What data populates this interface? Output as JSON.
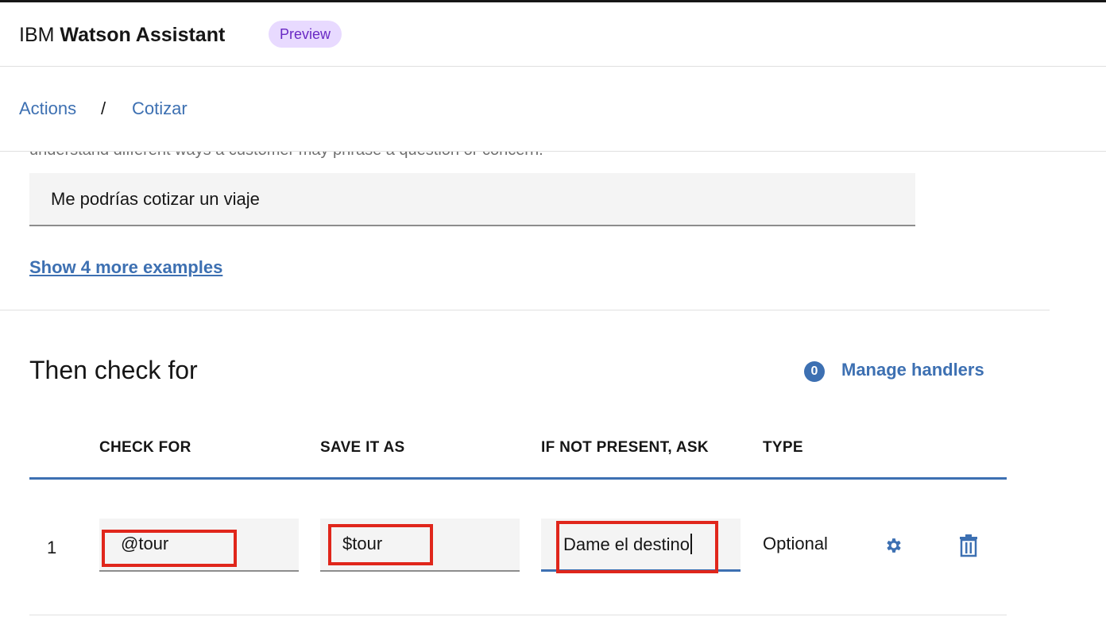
{
  "app": {
    "brand_prefix": "IBM",
    "brand_name": "Watson Assistant",
    "badge": "Preview"
  },
  "breadcrumb": {
    "items": [
      "Actions",
      "Cotizar"
    ],
    "separator": "/"
  },
  "intro": {
    "cut_off_text": "understand different ways a customer may phrase a question or concern."
  },
  "example": {
    "value": "Me podrías cotizar un viaje"
  },
  "show_more_label": "Show 4 more examples",
  "section": {
    "title": "Then check for",
    "handler_count": "0",
    "manage_label": "Manage handlers"
  },
  "table": {
    "headers": [
      "CHECK FOR",
      "SAVE IT AS",
      "IF NOT PRESENT, ASK",
      "TYPE"
    ],
    "rows": [
      {
        "index": "1",
        "check_for": "@tour",
        "save_as": "$tour",
        "ask": "Dame el destino",
        "type": "Optional"
      }
    ]
  },
  "colors": {
    "accent": "#3d70b2",
    "badge_bg": "#e8daff",
    "badge_text": "#6929c4",
    "highlight": "#e0261b"
  },
  "icons": {
    "settings": "gear-icon",
    "delete": "trash-icon"
  }
}
